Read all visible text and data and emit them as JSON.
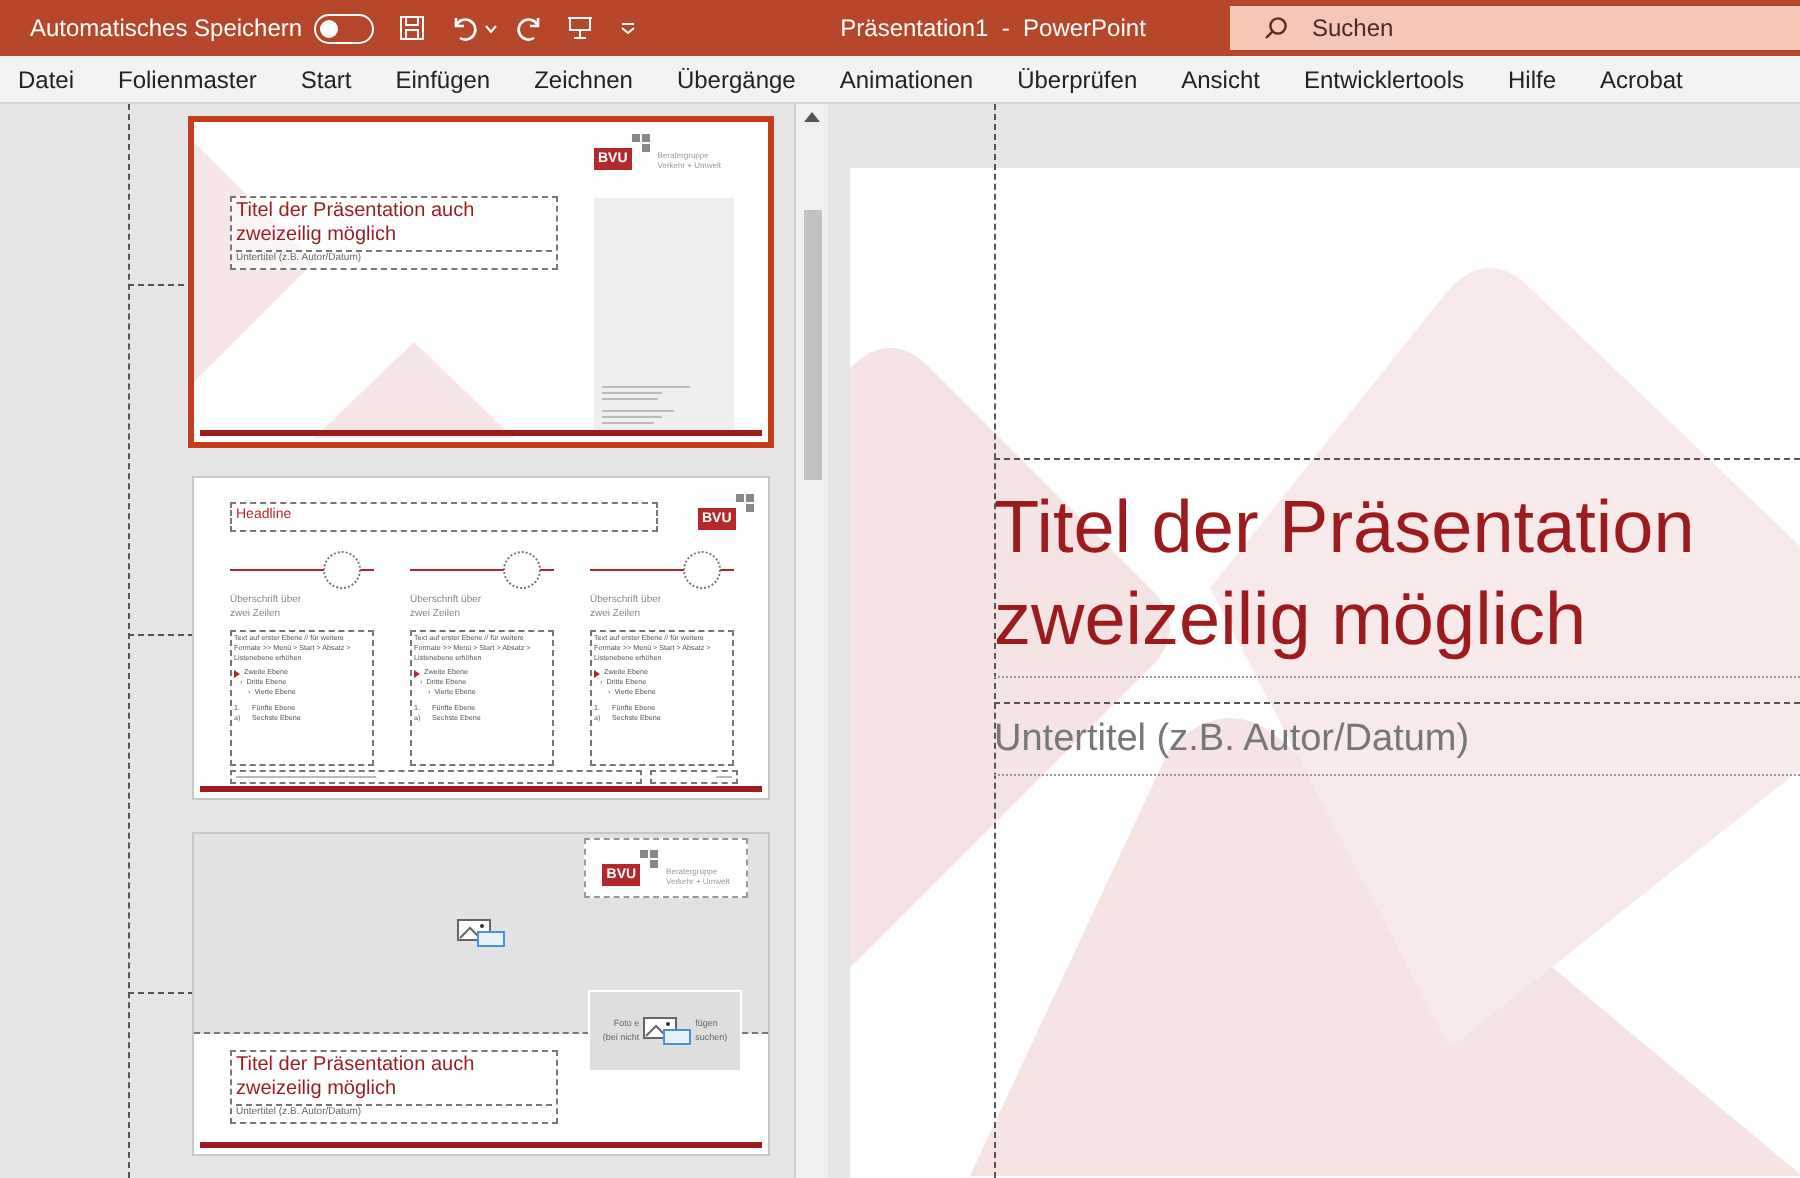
{
  "title_bar": {
    "autosave_label": "Automatisches Speichern",
    "autosave_on": false,
    "document_title": "Präsentation1  -  PowerPoint",
    "search_placeholder": "Suchen"
  },
  "menu": [
    "Datei",
    "Folienmaster",
    "Start",
    "Einfügen",
    "Zeichnen",
    "Übergänge",
    "Animationen",
    "Überprüfen",
    "Ansicht",
    "Entwicklertools",
    "Hilfe",
    "Acrobat"
  ],
  "thumbnails": [
    {
      "kind": "title",
      "selected": true,
      "title": "Titel der Präsentation auch zweizeilig möglich",
      "subtitle": "Untertitel (z.B. Autor/Datum)",
      "logo": "BVU",
      "logo_lines": [
        "Beratergruppe",
        "Verkehr + Umwelt"
      ]
    },
    {
      "kind": "content",
      "selected": false,
      "headline": "Headline",
      "logo": "BVU",
      "columns": [
        {
          "heading": "Überschrift über zwei Zeilen",
          "body": "Text auf erster Ebene // für weitere Formate >> Menü > Start > Absatz > Listenebene erhöhen",
          "items": [
            {
              "kind": "bullet",
              "text": "Zweite Ebene"
            },
            {
              "kind": "sub",
              "marker": "›",
              "text": "Dritte Ebene"
            },
            {
              "kind": "subsub",
              "marker": "›",
              "text": "Vierte Ebene"
            },
            {
              "kind": "numbered",
              "marker": "1.",
              "text": "Fünfte Ebene"
            },
            {
              "kind": "lettered",
              "marker": "a)",
              "text": "Sechste Ebene"
            }
          ]
        },
        {
          "heading": "Überschrift über zwei Zeilen",
          "body": "Text auf erster Ebene // für weitere Formate >> Menü > Start > Absatz > Listenebene erhöhen",
          "items": [
            {
              "kind": "bullet",
              "text": "Zweite Ebene"
            },
            {
              "kind": "sub",
              "marker": "›",
              "text": "Dritte Ebene"
            },
            {
              "kind": "subsub",
              "marker": "›",
              "text": "Vierte Ebene"
            },
            {
              "kind": "numbered",
              "marker": "1.",
              "text": "Fünfte Ebene"
            },
            {
              "kind": "lettered",
              "marker": "a)",
              "text": "Sechste Ebene"
            }
          ]
        },
        {
          "heading": "Überschrift über zwei Zeilen",
          "body": "Text auf erster Ebene // für weitere Formate >> Menü > Start > Absatz > Listenebene erhöhen",
          "items": [
            {
              "kind": "bullet",
              "text": "Zweite Ebene"
            },
            {
              "kind": "sub",
              "marker": "›",
              "text": "Dritte Ebene"
            },
            {
              "kind": "subsub",
              "marker": "›",
              "text": "Vierte Ebene"
            },
            {
              "kind": "numbered",
              "marker": "1.",
              "text": "Fünfte Ebene"
            },
            {
              "kind": "lettered",
              "marker": "a)",
              "text": "Sechste Ebene"
            }
          ]
        }
      ]
    },
    {
      "kind": "picture_title",
      "selected": false,
      "title": "Titel der Präsentation auch zweizeilig möglich",
      "subtitle": "Untertitel (z.B. Autor/Datum)",
      "logo": "BVU",
      "logo_lines": [
        "Beratergruppe",
        "Verkehr + Umwelt"
      ],
      "photo_hint_fragments": [
        "Foto e",
        "fügen",
        "(bei nicht",
        "suchen)"
      ]
    }
  ],
  "main_slide": {
    "title": "Titel der Präsentation zweizeilig möglich",
    "subtitle": "Untertitel (z.B. Autor/Datum)"
  }
}
